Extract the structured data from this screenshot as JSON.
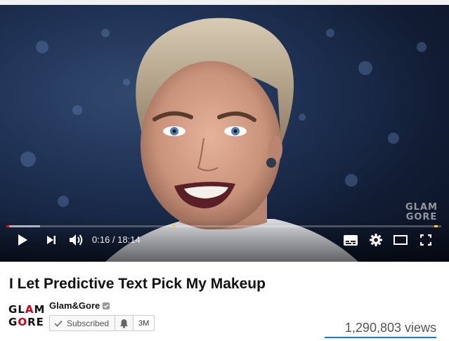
{
  "video": {
    "title": "I Let Predictive Text Pick My Makeup",
    "watermark_line1": "GLAM",
    "watermark_line2": "GORE",
    "progress_played_fraction": 0.007,
    "progress_loaded_fraction": 0.078,
    "chapter_markers_fraction": [
      0.389,
      0.992
    ],
    "time_current": "0:16",
    "time_separator": " / ",
    "time_total": "18:14",
    "accent_color": "#ff0000"
  },
  "controls": {
    "icons": [
      "play-icon",
      "next-icon",
      "volume-icon",
      "subtitles-icon",
      "settings-icon",
      "theater-mode-icon",
      "fullscreen-icon"
    ]
  },
  "channel": {
    "logo_line1": "GLAM",
    "logo_line2": "GORE",
    "name": "Glam&Gore",
    "subscribe_label": "Subscribed",
    "subscriber_count": "3M"
  },
  "stats": {
    "views": "1,290,803 views"
  }
}
